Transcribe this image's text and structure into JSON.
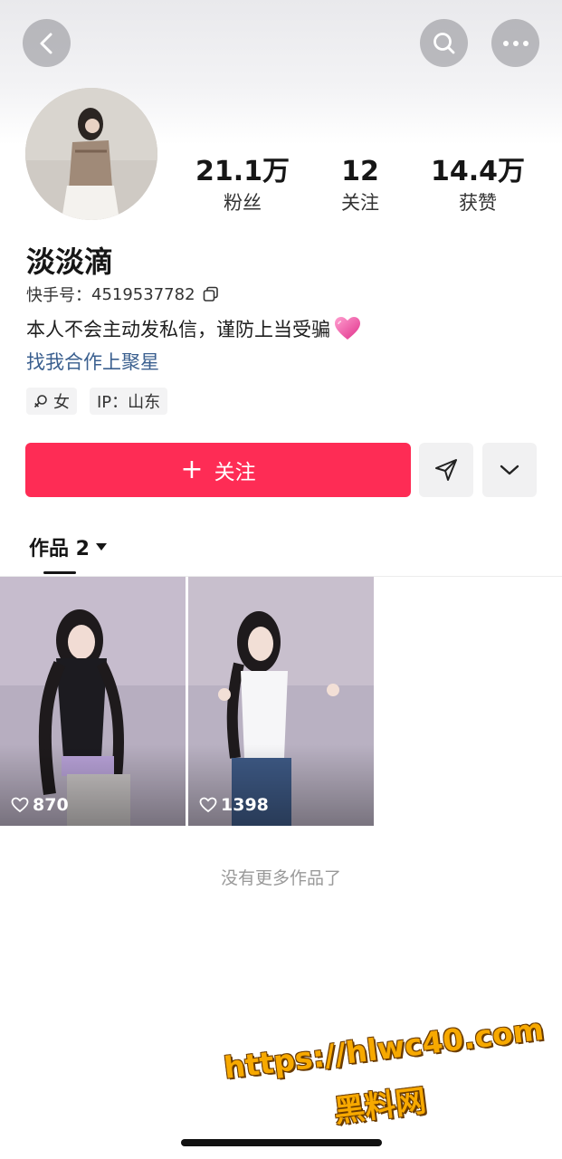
{
  "profile": {
    "nickname": "淡淡滴",
    "account_label": "快手号：",
    "account_id": "4519537782",
    "bio": "本人不会主动发私信，谨防上当受骗",
    "collab_link": "找我合作上聚星",
    "tags": {
      "gender": "女",
      "ip": "IP：山东"
    }
  },
  "stats": {
    "fans": {
      "value": "21.1万",
      "label": "粉丝"
    },
    "following": {
      "value": "12",
      "label": "关注"
    },
    "likes": {
      "value": "14.4万",
      "label": "获赞"
    }
  },
  "actions": {
    "follow_label": "关注",
    "follow_icon": "plus-icon",
    "share_icon": "paper-plane-icon",
    "expand_icon": "chevron-down-icon"
  },
  "header": {
    "back_icon": "chevron-left-icon",
    "search_icon": "search-icon",
    "more_icon": "more-dots-icon"
  },
  "works": {
    "tab_label": "作品 2",
    "items": [
      {
        "likes": "870"
      },
      {
        "likes": "1398"
      }
    ],
    "end_text": "没有更多作品了"
  },
  "watermark": {
    "url": "https://hlwc40.com",
    "name": "黑料网"
  },
  "colors": {
    "accent": "#fe2c55",
    "link": "#3a5f8f"
  }
}
